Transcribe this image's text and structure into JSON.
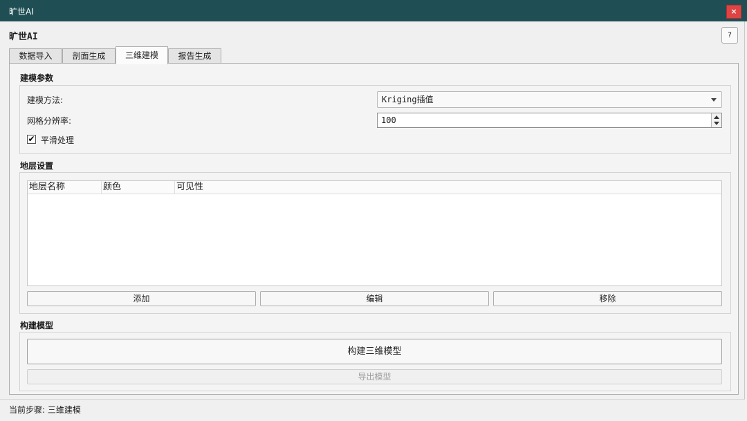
{
  "window": {
    "title": "旷世AI",
    "close_label": "×",
    "app_heading": "旷世AI",
    "help_label": "?"
  },
  "tabs": [
    {
      "label": "数据导入",
      "active": false
    },
    {
      "label": "剖面生成",
      "active": false
    },
    {
      "label": "三维建模",
      "active": true
    },
    {
      "label": "报告生成",
      "active": false
    }
  ],
  "modeling_params": {
    "title": "建模参数",
    "method_label": "建模方法:",
    "method_value": "Kriging插值",
    "resolution_label": "网格分辨率:",
    "resolution_value": "100",
    "smooth_label": "平滑处理",
    "smooth_checked": true,
    "check_mark": "✔"
  },
  "layer_settings": {
    "title": "地层设置",
    "columns": [
      "地层名称",
      "颜色",
      "可见性"
    ],
    "rows": [],
    "add_label": "添加",
    "edit_label": "编辑",
    "remove_label": "移除"
  },
  "build_model": {
    "title": "构建模型",
    "build_label": "构建三维模型",
    "export_label": "导出模型"
  },
  "status": {
    "text": "当前步骤: 三维建模"
  },
  "colors": {
    "titlebar": "#1f4f55",
    "close": "#e04343"
  }
}
